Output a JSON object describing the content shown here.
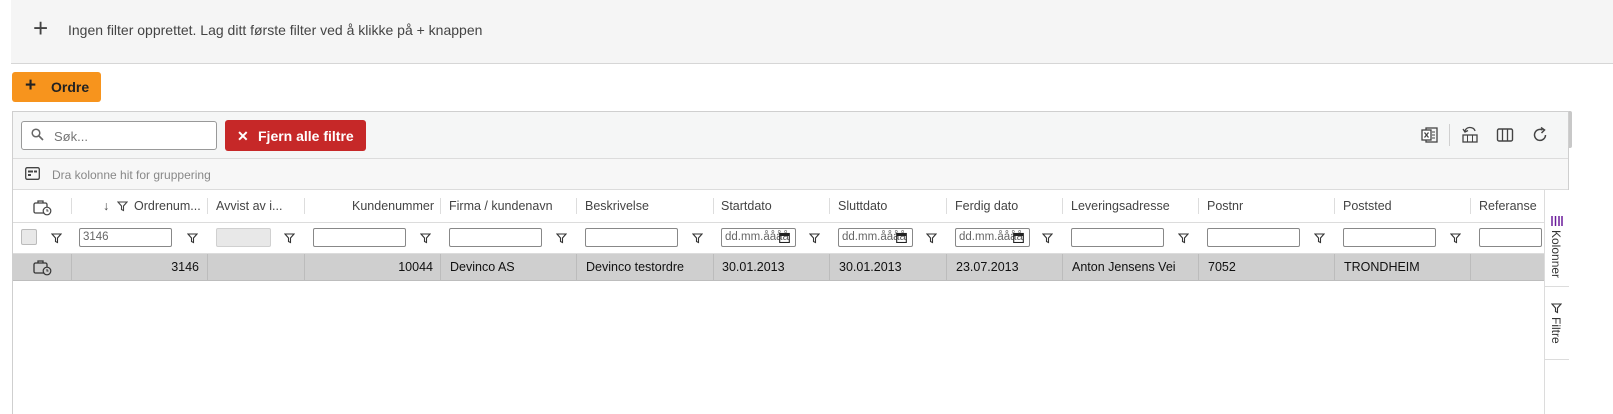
{
  "filter_bar": {
    "add_glyph": "+",
    "message": "Ingen filter opprettet. Lag ditt første filter ved å klikke på + knappen"
  },
  "new_order_button": {
    "glyph": "+",
    "label": "Ordre"
  },
  "toolbar": {
    "search_placeholder": "Søk...",
    "clear_filters_glyph": "✕",
    "clear_filters_label": "Fjern alle filtre",
    "icons": [
      "excel-export-icon",
      "reset-layout-icon",
      "columns-icon",
      "refresh-icon"
    ]
  },
  "group_bar": {
    "text": "Dra kolonne hit for gruppering"
  },
  "columns": [
    "Ordrenum...",
    "Avvist av i...",
    "Kundenummer",
    "Firma / kundenavn",
    "Beskrivelse",
    "Startdato",
    "Sluttdato",
    "Ferdig dato",
    "Leveringsadresse",
    "Postnr",
    "Poststed",
    "Referanse"
  ],
  "sort_arrow": "↓",
  "filters": {
    "ordrenummer": "3146",
    "date_placeholder": "dd.mm.åååå"
  },
  "rows": [
    {
      "ordrenummer": "3146",
      "avvist": "",
      "kundenummer": "10044",
      "firma": "Devinco AS",
      "beskrivelse": "Devinco testordre",
      "startdato": "30.01.2013",
      "sluttdato": "30.01.2013",
      "ferdig": "23.07.2013",
      "leveringsadresse": "Anton Jensens Vei",
      "postnr": "7052",
      "poststed": "TRONDHEIM",
      "referanse": ""
    }
  ],
  "side_panel": {
    "columns_tab": "Kolonner",
    "filters_tab": "Filtre"
  },
  "colors": {
    "accent": "#f7941d",
    "danger": "#c62828",
    "row_selected": "#cfcfcf"
  }
}
